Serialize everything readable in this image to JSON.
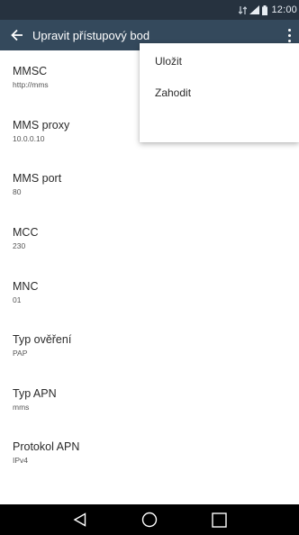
{
  "status_bar": {
    "time": "12:00",
    "icons": [
      "data-arrows-icon",
      "signal-icon",
      "battery-icon"
    ]
  },
  "app_bar": {
    "title": "Upravit přístupový bod",
    "back_icon": "back-arrow-icon",
    "overflow_icon": "overflow-menu-icon"
  },
  "menu": {
    "items": [
      {
        "label": "Uložit"
      },
      {
        "label": "Zahodit"
      }
    ]
  },
  "settings": [
    {
      "label": "MMSC",
      "value": "http://mms"
    },
    {
      "label": "MMS proxy",
      "value": "10.0.0.10"
    },
    {
      "label": "MMS port",
      "value": "80"
    },
    {
      "label": "MCC",
      "value": "230"
    },
    {
      "label": "MNC",
      "value": "01"
    },
    {
      "label": "Typ ověření",
      "value": "PAP"
    },
    {
      "label": "Typ APN",
      "value": "mms"
    },
    {
      "label": "Protokol APN",
      "value": "IPv4"
    }
  ],
  "nav_bar": {
    "back": "nav-back-icon",
    "home": "nav-home-icon",
    "recents": "nav-recents-icon"
  },
  "colors": {
    "status_bar": "#26323f",
    "app_bar": "#34495c",
    "nav_bar": "#000000"
  }
}
